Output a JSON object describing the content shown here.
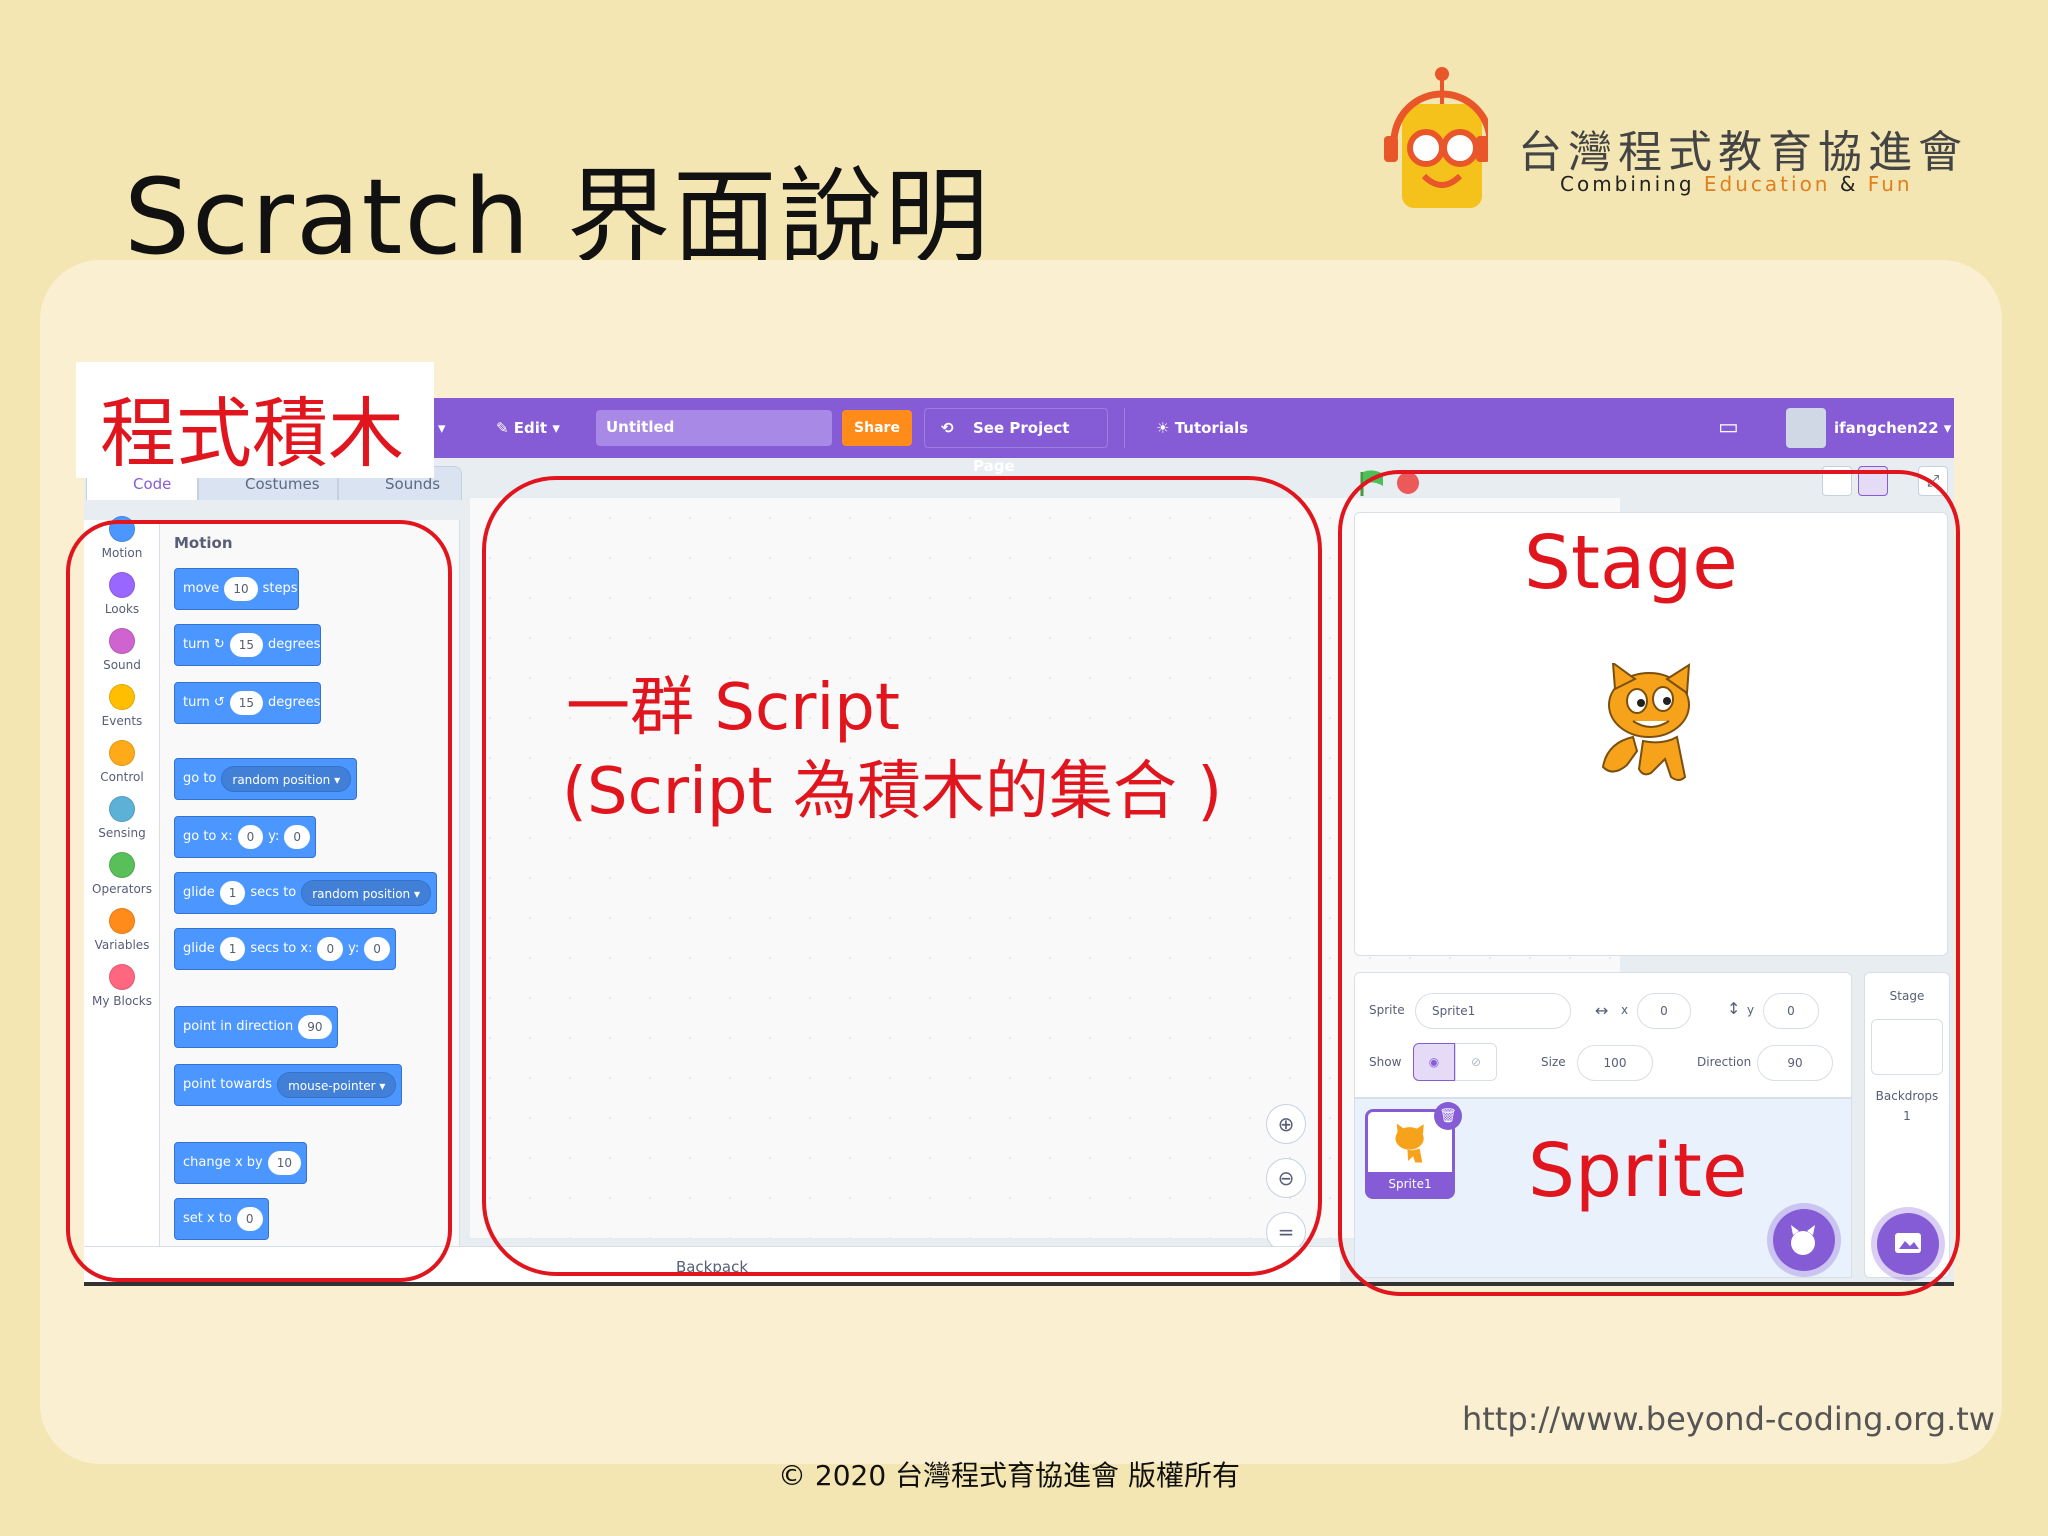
{
  "slide": {
    "title": "Scratch  界面說明",
    "org_name": "台灣程式教育協進會",
    "tagline_a": "Combining ",
    "tagline_b": "Education",
    "tagline_c": " & ",
    "tagline_d": "Fun",
    "url": "http://www.beyond-coding.org.tw",
    "copyright": "© 2020  台灣程式育協進會 版權所有"
  },
  "annotations": {
    "blocks_label": "程式積木",
    "script_line1": "一群 Script",
    "script_line2": "(Script  為積木的集合 )",
    "stage_label": "Stage",
    "sprite_label": "Sprite"
  },
  "menubar": {
    "edit": "Edit",
    "project_title": "Untitled",
    "share": "Share",
    "see_project": "See Project Page",
    "tutorials": "Tutorials",
    "username": "ifangchen22"
  },
  "tabs": [
    "Code",
    "Costumes",
    "Sounds"
  ],
  "categories": [
    {
      "label": "Motion",
      "color": "#4c97ff"
    },
    {
      "label": "Looks",
      "color": "#9966ff"
    },
    {
      "label": "Sound",
      "color": "#cf63cf"
    },
    {
      "label": "Events",
      "color": "#ffbf00"
    },
    {
      "label": "Control",
      "color": "#ffab19"
    },
    {
      "label": "Sensing",
      "color": "#5cb1d6"
    },
    {
      "label": "Operators",
      "color": "#59c059"
    },
    {
      "label": "Variables",
      "color": "#ff8c1a"
    },
    {
      "label": "My Blocks",
      "color": "#ff6680"
    }
  ],
  "palette": {
    "heading": "Motion",
    "move": {
      "a": "move",
      "v": "10",
      "b": "steps"
    },
    "turn_cw": {
      "a": "turn",
      "v": "15",
      "b": "degrees"
    },
    "turn_ccw": {
      "a": "turn",
      "v": "15",
      "b": "degrees"
    },
    "goto": {
      "a": "go to",
      "dd": "random position"
    },
    "goto_xy": {
      "a": "go to x:",
      "x": "0",
      "b": "y:",
      "y": "0"
    },
    "glide_to": {
      "a": "glide",
      "v": "1",
      "b": "secs to",
      "dd": "random position"
    },
    "glide_xy": {
      "a": "glide",
      "v": "1",
      "b": "secs to x:",
      "x": "0",
      "c": "y:",
      "y": "0"
    },
    "point_dir": {
      "a": "point in direction",
      "v": "90"
    },
    "point_towards": {
      "a": "point towards",
      "dd": "mouse-pointer"
    },
    "change_x": {
      "a": "change x by",
      "v": "10"
    },
    "set_x": {
      "a": "set x to",
      "v": "0"
    }
  },
  "backpack": "Backpack",
  "sprite_info": {
    "sprite_label": "Sprite",
    "sprite_name": "Sprite1",
    "x_label": "x",
    "x_value": "0",
    "y_label": "y",
    "y_value": "0",
    "show_label": "Show",
    "size_label": "Size",
    "size_value": "100",
    "direction_label": "Direction",
    "direction_value": "90"
  },
  "sprite_tile": "Sprite1",
  "stage_pane": {
    "title": "Stage",
    "backdrops_label": "Backdrops",
    "backdrops_count": "1"
  }
}
